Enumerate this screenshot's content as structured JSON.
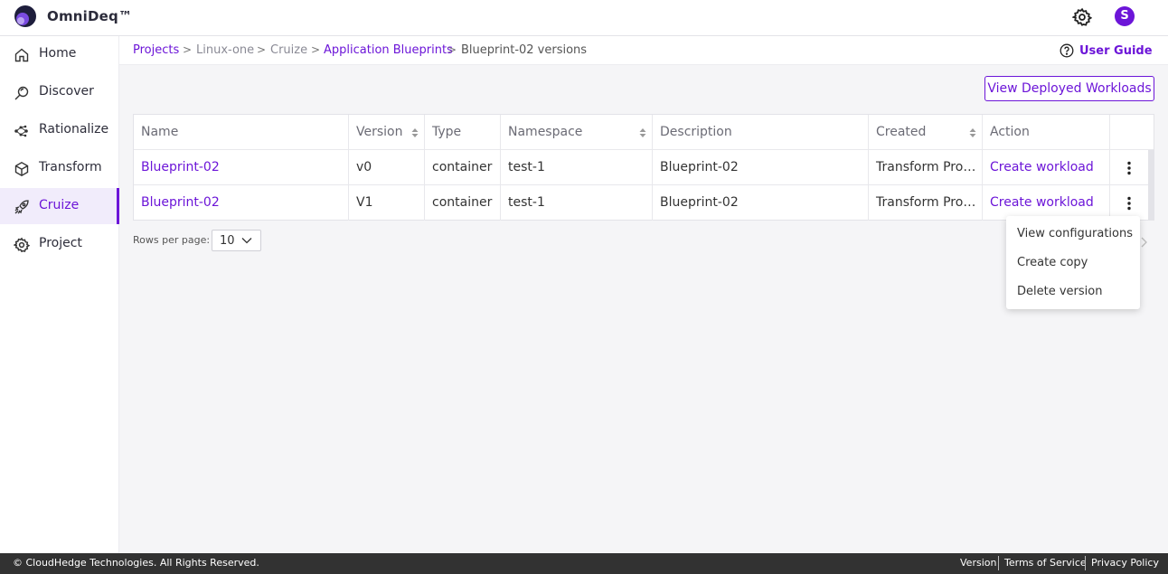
{
  "app": {
    "brand": "OmniDeq™"
  },
  "header": {
    "avatar_letter": "S"
  },
  "sidebar": {
    "items": [
      {
        "label": "Home",
        "icon": "home-icon"
      },
      {
        "label": "Discover",
        "icon": "discover-icon"
      },
      {
        "label": "Rationalize",
        "icon": "rationalize-icon"
      },
      {
        "label": "Transform",
        "icon": "cube-icon"
      },
      {
        "label": "Cruize",
        "icon": "rocket-icon",
        "active": true
      },
      {
        "label": "Project",
        "icon": "gear-icon"
      }
    ]
  },
  "breadcrumb": {
    "items": [
      "Projects",
      "Linux-one",
      "Cruize",
      "Application Blueprints",
      "Blueprint-02 versions"
    ],
    "separator": ">"
  },
  "user_guide": "User Guide",
  "actions": {
    "view_deployed": "View Deployed Workloads"
  },
  "table": {
    "columns": [
      "Name",
      "Version",
      "Type",
      "Namespace",
      "Description",
      "Created",
      "Action"
    ],
    "rows": [
      {
        "name": "Blueprint-02",
        "version": "v0",
        "type": "container",
        "namespace": "test-1",
        "description": "Blueprint-02",
        "created": "Transform Profi...",
        "action": "Create workload"
      },
      {
        "name": "Blueprint-02",
        "version": "V1",
        "type": "container",
        "namespace": "test-1",
        "description": "Blueprint-02",
        "created": "Transform Profi...",
        "action": "Create workload"
      }
    ]
  },
  "pagination": {
    "rows_per_page_label": "Rows per page:",
    "rows_per_page": "10"
  },
  "context_menu": {
    "items": [
      "View configurations",
      "Create copy",
      "Delete version"
    ]
  },
  "footer": {
    "copyright": "© CloudHedge Technologies. All Rights Reserved.",
    "links": [
      "Version",
      "Terms of Service",
      "Privacy Policy"
    ]
  },
  "colors": {
    "accent": "#6c15d8",
    "footer_bg": "#323232",
    "main_bg": "#f5f5f7"
  }
}
